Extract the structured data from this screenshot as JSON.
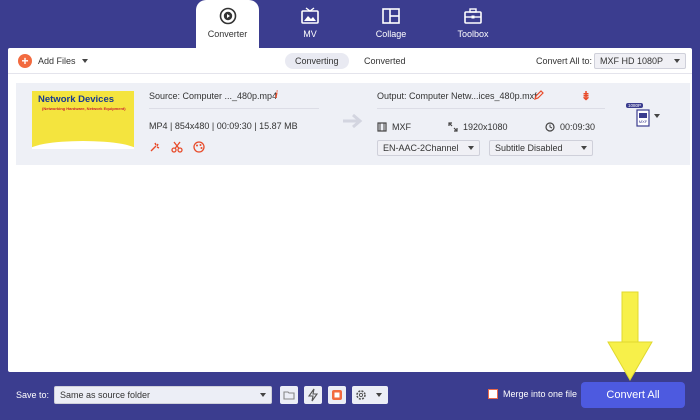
{
  "nav": {
    "tabs": [
      {
        "label": "Converter",
        "icon": "converter-icon",
        "active": true
      },
      {
        "label": "MV",
        "icon": "mv-icon"
      },
      {
        "label": "Collage",
        "icon": "collage-icon"
      },
      {
        "label": "Toolbox",
        "icon": "toolbox-icon"
      }
    ]
  },
  "toolbar": {
    "add_files": "Add Files",
    "tab_converting": "Converting",
    "tab_converted": "Converted",
    "convert_all_label": "Convert All to:",
    "convert_all_value": "MXF HD 1080P"
  },
  "file": {
    "thumb_title": "Network Devices",
    "thumb_subtitle": "(Networking Hardware, Network Equipment)",
    "source": "Source: Computer ..._480p.mp4",
    "meta": "MP4 | 854x480 | 00:09:30 | 15.87 MB",
    "output": "Output: Computer Netw...ices_480p.mxf",
    "out_format": "MXF",
    "out_resolution": "1920x1080",
    "out_duration": "00:09:30",
    "audio_track": "EN-AAC-2Channel",
    "subtitle": "Subtitle Disabled",
    "format_badge": "1080P",
    "format_badge_sub": "MXF"
  },
  "bottom": {
    "save_to_label": "Save to:",
    "save_to_value": "Same as source folder",
    "merge_label": "Merge into one file",
    "convert_button": "Convert All"
  },
  "colors": {
    "background": "#3b3d8f",
    "accent": "#4d5ae0",
    "orange": "#f26a3f",
    "pointer": "#f7f04a"
  }
}
